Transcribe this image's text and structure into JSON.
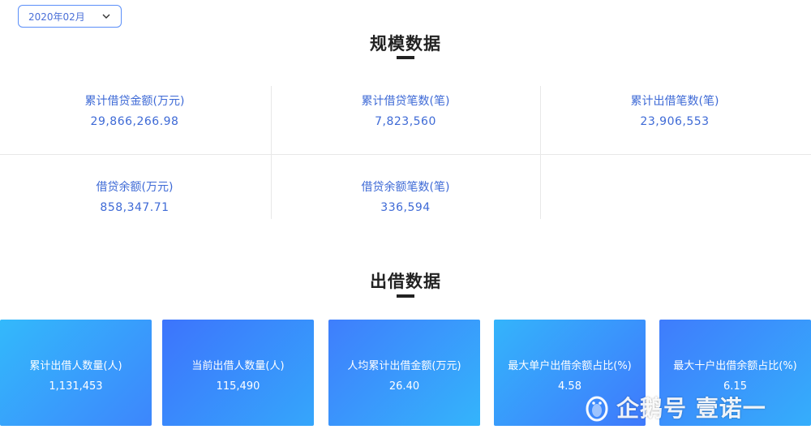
{
  "filter": {
    "selected_month": "2020年02月"
  },
  "scale_section": {
    "title": "规模数据",
    "stats": [
      {
        "label": "累计借贷金额(万元)",
        "value": "29,866,266.98"
      },
      {
        "label": "累计借贷笔数(笔)",
        "value": "7,823,560"
      },
      {
        "label": "累计出借笔数(笔)",
        "value": "23,906,553"
      },
      {
        "label": "借贷余额(万元)",
        "value": "858,347.71"
      },
      {
        "label": "借贷余额笔数(笔)",
        "value": "336,594"
      }
    ]
  },
  "lending_section": {
    "title": "出借数据",
    "cards": [
      {
        "label": "累计出借人数量(人)",
        "value": "1,131,453"
      },
      {
        "label": "当前出借人数量(人)",
        "value": "115,490"
      },
      {
        "label": "人均累计出借金额(万元)",
        "value": "26.40"
      },
      {
        "label": "最大单户出借余额占比(%)",
        "value": "4.58"
      },
      {
        "label": "最大十户出借余额占比(%)",
        "value": "6.15"
      }
    ]
  },
  "watermark": {
    "text": "企鹅号 壹诺一",
    "icon": "penguin-icon"
  },
  "colors": {
    "accent": "#3e6ad6",
    "card_gradient_a": "#34b8fb",
    "card_gradient_b": "#3f7bfc",
    "underline": "#d81e3c"
  }
}
